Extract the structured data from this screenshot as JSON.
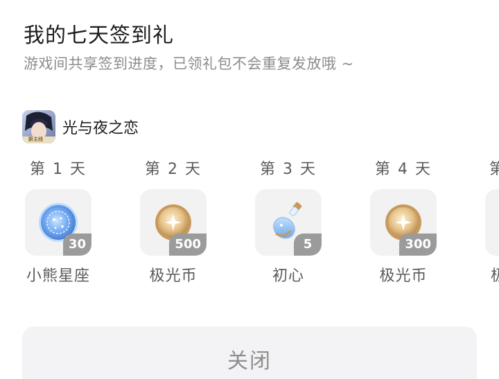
{
  "dialog": {
    "title": "我的七天签到礼",
    "subtitle": "游戏间共享签到进度，已领礼包不会重复发放哦 ~"
  },
  "game": {
    "name": "光与夜之恋",
    "icon_badge": "新主线",
    "icon": "game-avatar-icon"
  },
  "days": [
    {
      "label": "第 1 天",
      "reward": "小熊星座",
      "qty": "30",
      "icon": "constellation-orb-icon"
    },
    {
      "label": "第 2 天",
      "reward": "极光币",
      "qty": "500",
      "icon": "aurora-coin-icon"
    },
    {
      "label": "第 3 天",
      "reward": "初心",
      "qty": "5",
      "icon": "potion-bottle-icon"
    },
    {
      "label": "第 4 天",
      "reward": "极光币",
      "qty": "300",
      "icon": "aurora-coin-icon"
    },
    {
      "label": "第",
      "reward": "极",
      "qty": "",
      "icon": "partial-reward-icon"
    }
  ],
  "actions": {
    "close_label": "关闭"
  }
}
